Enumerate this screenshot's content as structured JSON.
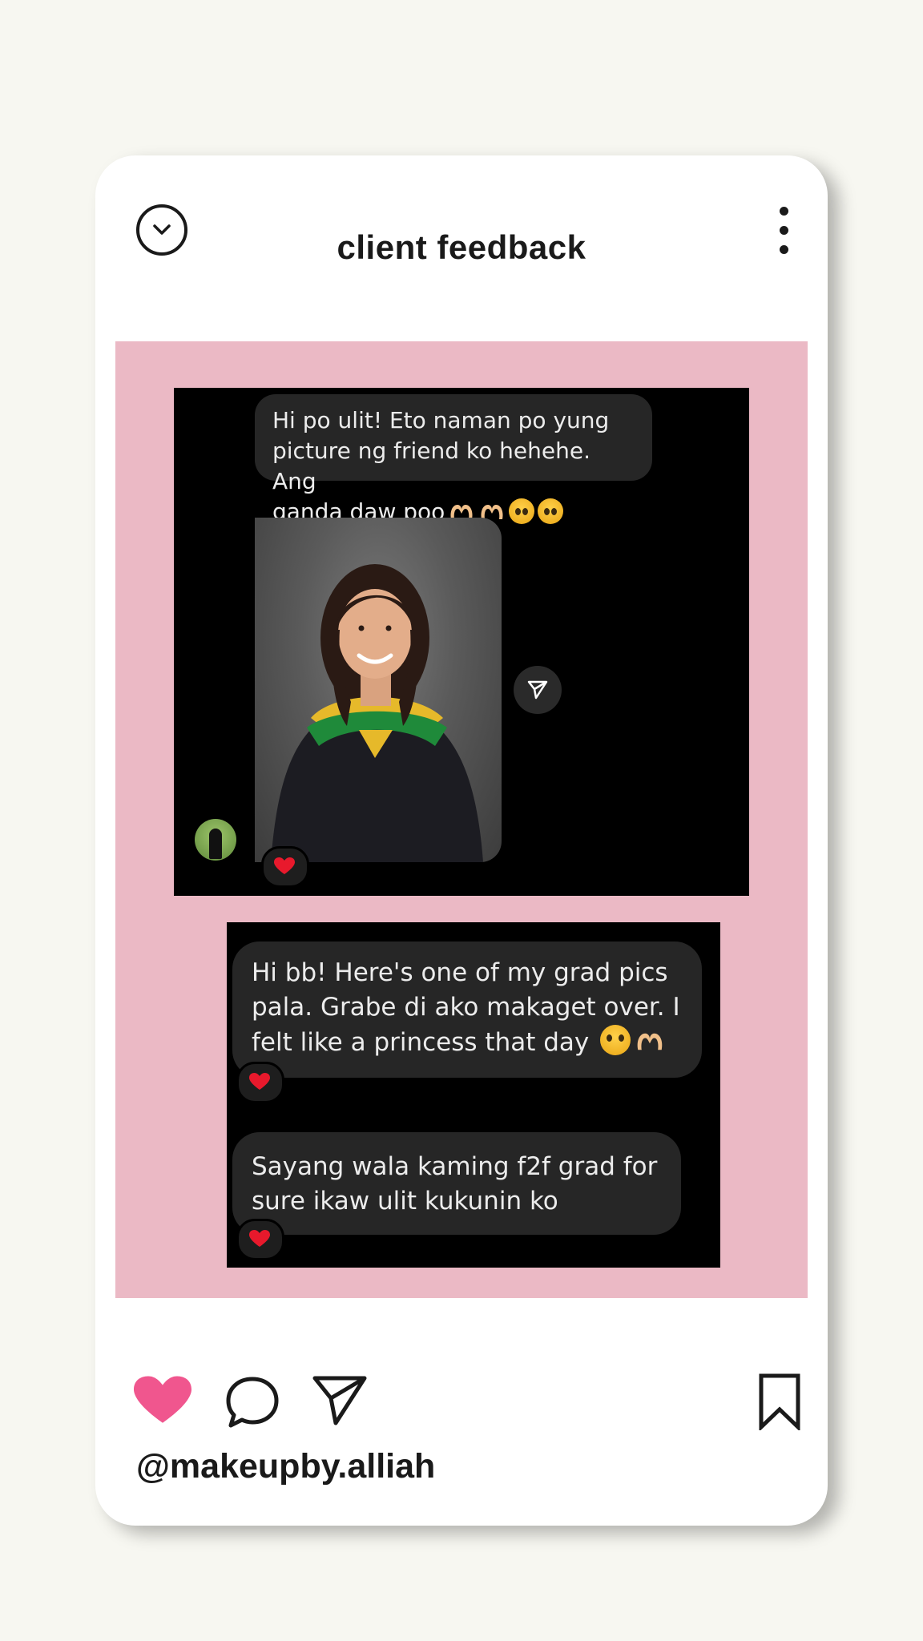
{
  "post": {
    "title": "client feedback",
    "handle": "@makeupby.alliah"
  },
  "chat1": {
    "message": "Hi po ulit! Eto naman po yung picture ng friend ko hehehe. Ang ganda daw poo",
    "message_lines": [
      "Hi po ulit! Eto naman po yung",
      "picture ng friend ko hehehe. Ang",
      "ganda daw poo"
    ],
    "reaction": "heart"
  },
  "chat2": {
    "message1_lines": [
      "Hi bb! Here's one of my grad pics",
      "pala. Grabe di ako makaget over. I",
      "felt like a princess that day"
    ],
    "message2_lines": [
      "Sayang wala kaming f2f grad for",
      "sure ikaw ulit kukunin ko"
    ],
    "reaction": "heart"
  },
  "colors": {
    "page_bg": "#f7f7f1",
    "card_bg": "#ffffff",
    "panel_bg": "#ebb9c5",
    "like_heart": "#f0568e",
    "chat_bubble": "#262626",
    "reaction_heart": "#e8192c"
  },
  "icons": {
    "header_left": "chevron-down-circle-icon",
    "header_right": "more-vertical-icon",
    "actions": [
      "heart-icon",
      "comment-icon",
      "send-icon",
      "bookmark-icon"
    ]
  }
}
